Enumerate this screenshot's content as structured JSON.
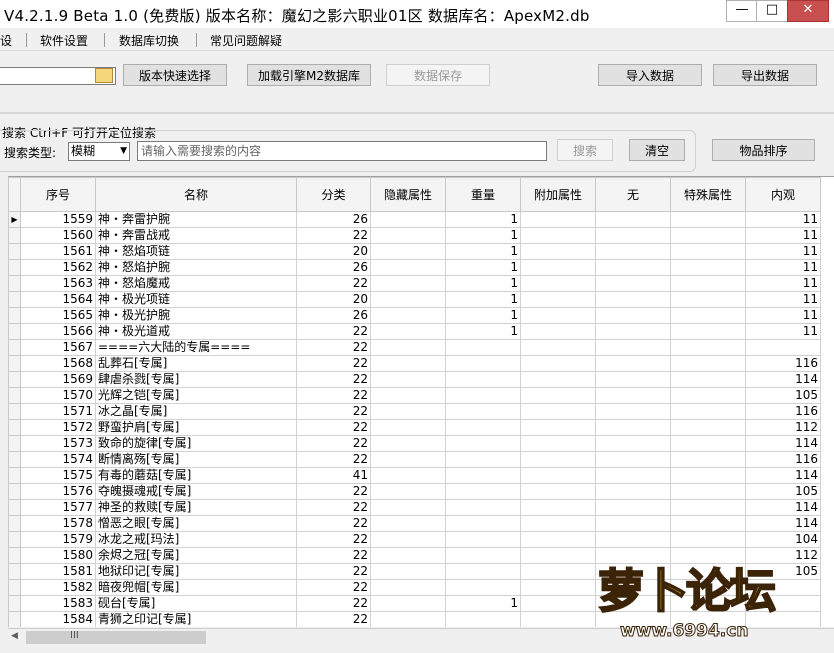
{
  "window": {
    "title": "V4.2.1.9    Beta 1.0 (免费版)    版本名称：魔幻之影六职业01区    数据库名：ApexM2.db",
    "minimize": "—",
    "maximize": "□",
    "close": "✕"
  },
  "menu": [
    "设",
    "软件设置",
    "数据库切换",
    "常见问题解疑"
  ],
  "toolbar": {
    "version_quick_select": "版本快速选择",
    "load_engine_db": "加载引擎M2数据库",
    "save_data": "数据保存",
    "import_data": "导入数据",
    "export_data": "导出数据"
  },
  "search": {
    "hint": "搜索  Ctrl+F 可打开定位搜索",
    "type_label": "搜索类型:",
    "type_value": "模糊",
    "placeholder": "请输入需要搜索的内容",
    "search_button": "搜索",
    "clear_button": "清空",
    "sort_button": "物品排序"
  },
  "table": {
    "columns": [
      "序号",
      "名称",
      "分类",
      "隐藏属性",
      "重量",
      "附加属性",
      "无",
      "特殊属性",
      "内观"
    ],
    "rows": [
      [
        "1559",
        "神・奔雷护腕",
        "26",
        "",
        "1",
        "",
        "",
        "",
        "11"
      ],
      [
        "1560",
        "神・奔雷战戒",
        "22",
        "",
        "1",
        "",
        "",
        "",
        "11"
      ],
      [
        "1561",
        "神・怒焰项链",
        "20",
        "",
        "1",
        "",
        "",
        "",
        "11"
      ],
      [
        "1562",
        "神・怒焰护腕",
        "26",
        "",
        "1",
        "",
        "",
        "",
        "11"
      ],
      [
        "1563",
        "神・怒焰魔戒",
        "22",
        "",
        "1",
        "",
        "",
        "",
        "11"
      ],
      [
        "1564",
        "神・极光项链",
        "20",
        "",
        "1",
        "",
        "",
        "",
        "11"
      ],
      [
        "1565",
        "神・极光护腕",
        "26",
        "",
        "1",
        "",
        "",
        "",
        "11"
      ],
      [
        "1566",
        "神・极光道戒",
        "22",
        "",
        "1",
        "",
        "",
        "",
        "11"
      ],
      [
        "1567",
        "====六大陆的专属====",
        "22",
        "",
        "",
        "",
        "",
        "",
        ""
      ],
      [
        "1568",
        "乱葬石[专属]",
        "22",
        "",
        "",
        "",
        "",
        "",
        "116"
      ],
      [
        "1569",
        "肆虐杀戮[专属]",
        "22",
        "",
        "",
        "",
        "",
        "",
        "114"
      ],
      [
        "1570",
        "光辉之铠[专属]",
        "22",
        "",
        "",
        "",
        "",
        "",
        "105"
      ],
      [
        "1571",
        "冰之晶[专属]",
        "22",
        "",
        "",
        "",
        "",
        "",
        "116"
      ],
      [
        "1572",
        "野蛮护肩[专属]",
        "22",
        "",
        "",
        "",
        "",
        "",
        "112"
      ],
      [
        "1573",
        "致命的旋律[专属]",
        "22",
        "",
        "",
        "",
        "",
        "",
        "114"
      ],
      [
        "1574",
        "断情离殇[专属]",
        "22",
        "",
        "",
        "",
        "",
        "",
        "116"
      ],
      [
        "1575",
        "有毒的蘑菇[专属]",
        "41",
        "",
        "",
        "",
        "",
        "",
        "114"
      ],
      [
        "1576",
        "夺魄摄魂戒[专属]",
        "22",
        "",
        "",
        "",
        "",
        "",
        "105"
      ],
      [
        "1577",
        "神圣的救赎[专属]",
        "22",
        "",
        "",
        "",
        "",
        "",
        "114"
      ],
      [
        "1578",
        "憎恶之眼[专属]",
        "22",
        "",
        "",
        "",
        "",
        "",
        "114"
      ],
      [
        "1579",
        "冰龙之戒[玛法]",
        "22",
        "",
        "",
        "",
        "",
        "",
        "104"
      ],
      [
        "1580",
        "余烬之冠[专属]",
        "22",
        "",
        "",
        "",
        "",
        "",
        "112"
      ],
      [
        "1581",
        "地狱印记[专属]",
        "22",
        "",
        "",
        "",
        "",
        "",
        "105"
      ],
      [
        "1582",
        "暗夜兜帽[专属]",
        "22",
        "",
        "",
        "",
        "",
        "",
        ""
      ],
      [
        "1583",
        "砚台[专属]",
        "22",
        "",
        "1",
        "",
        "",
        "",
        ""
      ],
      [
        "1584",
        "青狮之印记[专属]",
        "22",
        "",
        "",
        "",
        "",
        "",
        ""
      ]
    ]
  },
  "scrollbar": {
    "grip": "III"
  },
  "watermark": {
    "title": "萝卜论坛",
    "url": "www.6994.cn"
  }
}
